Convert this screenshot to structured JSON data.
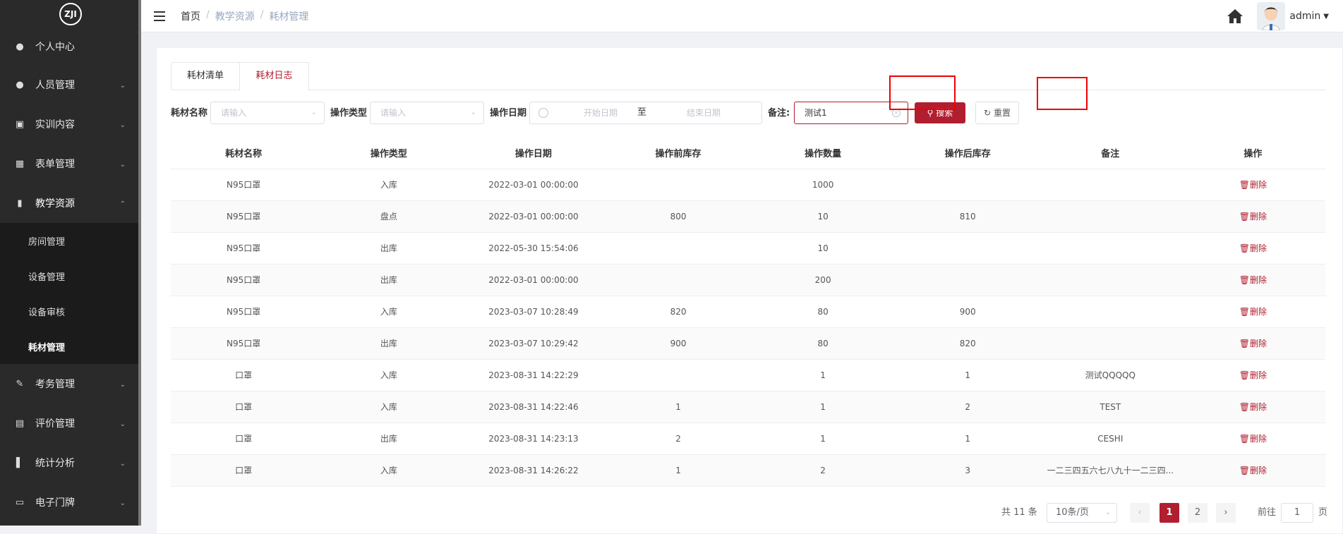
{
  "app": {
    "logo_text": "ZJI"
  },
  "sidebar": {
    "items": [
      {
        "label": "个人中心",
        "icon": "user-icon"
      },
      {
        "label": "人员管理",
        "icon": "users-icon"
      },
      {
        "label": "实训内容",
        "icon": "training-icon"
      },
      {
        "label": "表单管理",
        "icon": "form-icon"
      },
      {
        "label": "教学资源",
        "icon": "resource-icon"
      },
      {
        "label": "考务管理",
        "icon": "exam-icon"
      },
      {
        "label": "评价管理",
        "icon": "evaluate-icon"
      },
      {
        "label": "统计分析",
        "icon": "chart-icon"
      },
      {
        "label": "电子门牌",
        "icon": "monitor-icon"
      }
    ],
    "submenu": [
      {
        "label": "房间管理"
      },
      {
        "label": "设备管理"
      },
      {
        "label": "设备审核"
      },
      {
        "label": "耗材管理"
      }
    ]
  },
  "header": {
    "breadcrumb": [
      "首页",
      "教学资源",
      "耗材管理"
    ],
    "username": "admin"
  },
  "tabs": [
    "耗材清单",
    "耗材日志"
  ],
  "filters": {
    "name_label": "耗材名称",
    "name_placeholder": "请输入",
    "type_label": "操作类型",
    "type_placeholder": "请输入",
    "date_label": "操作日期",
    "date_start": "开始日期",
    "date_sep": "至",
    "date_end": "结束日期",
    "remark_label": "备注:",
    "remark_value": "测试1",
    "search_label": "搜索",
    "reset_label": "重置"
  },
  "table": {
    "headers": [
      "耗材名称",
      "操作类型",
      "操作日期",
      "操作前库存",
      "操作数量",
      "操作后库存",
      "备注",
      "操作"
    ],
    "delete_label": "删除",
    "rows": [
      [
        "N95口罩",
        "入库",
        "2022-03-01 00:00:00",
        "",
        "1000",
        "",
        ""
      ],
      [
        "N95口罩",
        "盘点",
        "2022-03-01 00:00:00",
        "800",
        "10",
        "810",
        ""
      ],
      [
        "N95口罩",
        "出库",
        "2022-05-30 15:54:06",
        "",
        "10",
        "",
        ""
      ],
      [
        "N95口罩",
        "出库",
        "2022-03-01 00:00:00",
        "",
        "200",
        "",
        ""
      ],
      [
        "N95口罩",
        "入库",
        "2023-03-07 10:28:49",
        "820",
        "80",
        "900",
        ""
      ],
      [
        "N95口罩",
        "出库",
        "2023-03-07 10:29:42",
        "900",
        "80",
        "820",
        ""
      ],
      [
        "口罩",
        "入库",
        "2023-08-31 14:22:29",
        "",
        "1",
        "1",
        "测试QQQQQ"
      ],
      [
        "口罩",
        "入库",
        "2023-08-31 14:22:46",
        "1",
        "1",
        "2",
        "TEST"
      ],
      [
        "口罩",
        "出库",
        "2023-08-31 14:23:13",
        "2",
        "1",
        "1",
        "CESHI"
      ],
      [
        "口罩",
        "入库",
        "2023-08-31 14:26:22",
        "1",
        "2",
        "3",
        "一二三四五六七八九十一二三四..."
      ]
    ]
  },
  "pagination": {
    "total": "共 11 条",
    "page_size": "10条/页",
    "pages": [
      "1",
      "2"
    ],
    "goto_prefix": "前往",
    "goto_value": "1",
    "goto_suffix": "页"
  }
}
